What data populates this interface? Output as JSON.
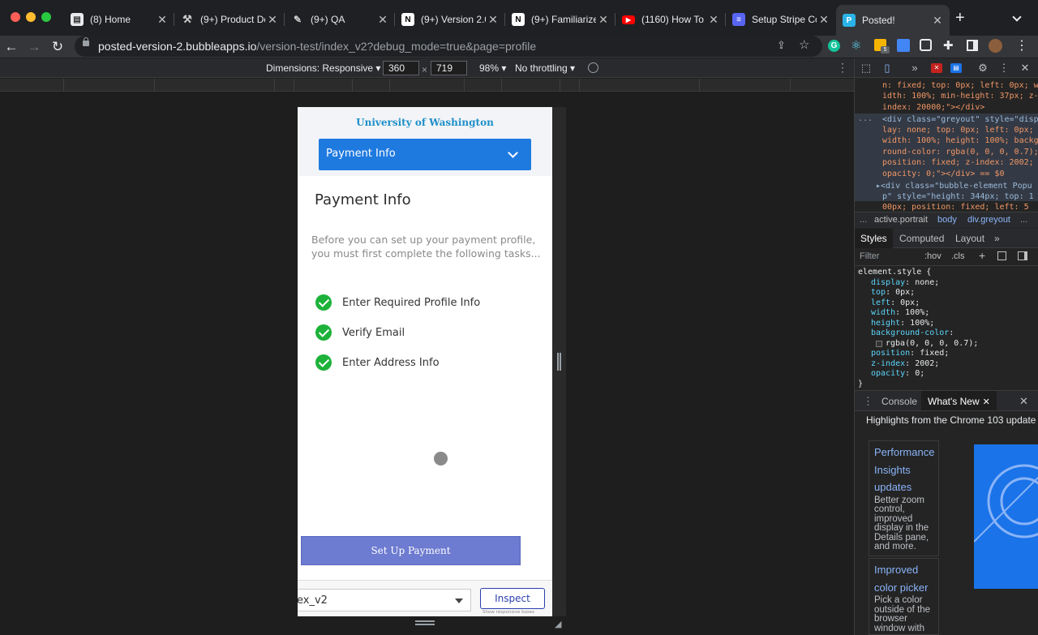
{
  "tabs": [
    {
      "title": "(8) Home",
      "favicon_color": "#e8eaed",
      "favicon_glyph": "▤"
    },
    {
      "title": "(9+) Product De",
      "favicon_color": "#3c3c3c",
      "favicon_glyph": "⚒"
    },
    {
      "title": "(9+) QA",
      "favicon_color": "#3c3c3c",
      "favicon_glyph": "🔧"
    },
    {
      "title": "(9+) Version 2.0",
      "favicon_color": "#3c3c3c",
      "favicon_glyph": "N"
    },
    {
      "title": "(9+) Familiarize",
      "favicon_color": "#3c3c3c",
      "favicon_glyph": "N"
    },
    {
      "title": "(1160) How To I",
      "favicon_color": "#ff0000",
      "favicon_glyph": "▶"
    },
    {
      "title": "Setup Stripe Co",
      "favicon_color": "#5865f2",
      "favicon_glyph": "≡"
    },
    {
      "title": "Posted!",
      "favicon_color": "#2ab3e8",
      "favicon_glyph": "P"
    }
  ],
  "address": {
    "host": "posted-version-2.bubbleapps.io",
    "path": "/version-test/index_v2?debug_mode=true&page=profile"
  },
  "device_toolbar": {
    "dimensions_label": "Dimensions: Responsive ▾",
    "width": "360",
    "height": "719",
    "times": "×",
    "zoom": "98% ▾",
    "throttle": "No throttling ▾"
  },
  "app": {
    "university": "University of Washington",
    "dropdown_label": "Payment Info",
    "section_title": "Payment Info",
    "description": "Before you can set up your payment profile, you must first complete the following tasks...",
    "tasks": [
      "Enter Required Profile Info",
      "Verify Email",
      "Enter Address Info"
    ],
    "setup_button": "Set Up Payment",
    "debug_page_value": "ex_v2",
    "inspect_button": "Inspect",
    "inspect_sub": "Show responsive boxes"
  },
  "devtools": {
    "code_lines": [
      "n: fixed; top: 0px; left: 0px; w",
      "idth: 100%; min-height: 37px; z-",
      "index: 20000;\"></div>",
      "<div class=\"greyout\" style=\"disp",
      "lay: none; top: 0px; left: 0px;",
      "width: 100%; height: 100%; backg",
      "round-color: rgba(0, 0, 0, 0.7);",
      "position: fixed; z-index: 2002;",
      "opacity: 0;\"></div> == $0",
      "▸<div class=\"bubble-element Popu",
      "p\" style=\"height: 344px; top: 1",
      "00px; position: fixed; left: 5"
    ],
    "breadcrumbs": [
      "...",
      "active.portrait",
      "body",
      "div.greyout",
      "..."
    ],
    "style_tabs": [
      "Styles",
      "Computed",
      "Layout",
      "»"
    ],
    "filter_placeholder": "Filter",
    "hov": ":hov",
    "cls": ".cls",
    "element_style_header": "element.style {",
    "styles": [
      {
        "prop": "display",
        "value": "none;"
      },
      {
        "prop": "top",
        "value": "0px;"
      },
      {
        "prop": "left",
        "value": "0px;"
      },
      {
        "prop": "width",
        "value": "100%;"
      },
      {
        "prop": "height",
        "value": "100%;"
      },
      {
        "prop": "background-color",
        "value": ""
      },
      {
        "prop": "",
        "value": "rgba(0, 0, 0, 0.7);"
      },
      {
        "prop": "position",
        "value": "fixed;"
      },
      {
        "prop": "z-index",
        "value": "2002;"
      },
      {
        "prop": "opacity",
        "value": "0;"
      }
    ],
    "closing_brace": "}",
    "console_tab": "Console",
    "whatsnew_tab": "What's New",
    "whatsnew_heading": "Highlights from the Chrome 103 update",
    "cards": [
      {
        "title_lines": [
          "Performance",
          "Insights",
          "updates"
        ],
        "body_lines": [
          "Better zoom",
          "control,",
          "improved",
          "display in the",
          "Details pane,",
          "and more."
        ]
      },
      {
        "title_lines": [
          "Improved",
          "color picker"
        ],
        "body_lines": [
          "Pick a color",
          "outside of the",
          "browser",
          "window with"
        ]
      }
    ]
  }
}
